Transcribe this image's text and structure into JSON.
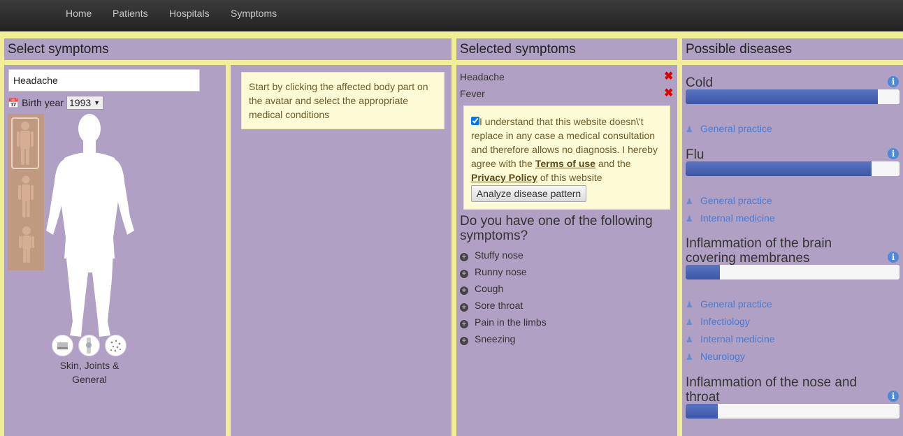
{
  "nav": {
    "items": [
      "Home",
      "Patients",
      "Hospitals",
      "Symptoms"
    ]
  },
  "headers": {
    "select_symptoms": "Select symptoms",
    "selected_symptoms": "Selected symptoms",
    "possible_diseases": "Possible diseases"
  },
  "search": {
    "value": "Headache"
  },
  "birth": {
    "label": "Birth year",
    "value": "1993"
  },
  "category": {
    "label": "Skin, Joints & General"
  },
  "hint": {
    "text": "Start by clicking the affected body part on the avatar and select the appropriate medical conditions"
  },
  "selected": [
    "Headache",
    "Fever"
  ],
  "consent": {
    "checked": true,
    "text1": "I understand that this website doesn\\'t replace in any case a medical consultation and therefore allows no diagnosis. I hereby agree with the ",
    "terms": "Terms of use",
    "text2": " and the ",
    "privacy": "Privacy Policy",
    "text3": " of this website",
    "button": "Analyze disease pattern"
  },
  "question": "Do you have one of the following symptoms?",
  "suggestions": [
    "Stuffy nose",
    "Runny nose",
    "Cough",
    "Sore throat",
    "Pain in the limbs",
    "Sneezing"
  ],
  "diseases": [
    {
      "name": "Cold",
      "probability": 0.9,
      "specialists": [
        "General practice"
      ]
    },
    {
      "name": "Flu",
      "probability": 0.87,
      "specialists": [
        "General practice",
        "Internal medicine"
      ]
    },
    {
      "name": "Inflammation of the brain covering membranes",
      "probability": 0.16,
      "specialists": [
        "General practice",
        "Infectiology",
        "Internal medicine",
        "Neurology"
      ]
    },
    {
      "name": "Inflammation of the nose and throat",
      "probability": 0.15,
      "specialists": []
    }
  ],
  "colors": {
    "panel": "#b0a0c4",
    "background": "#f2ee96",
    "bar": "#3a57a8",
    "remove": "#e00000",
    "link": "#4a7ad0"
  }
}
